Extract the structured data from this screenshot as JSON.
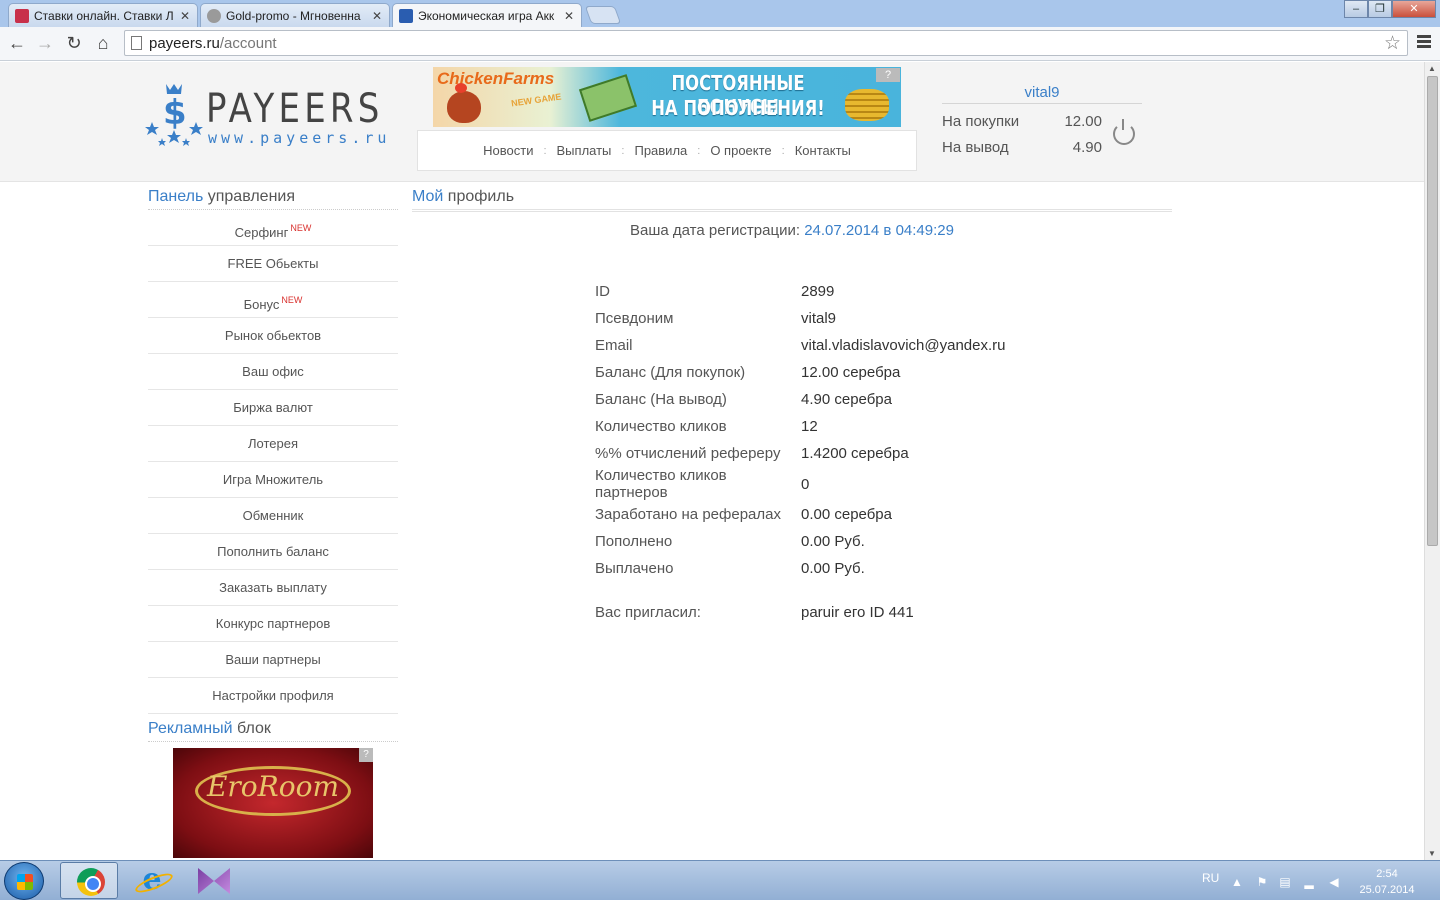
{
  "browser": {
    "tabs": [
      {
        "title": "Ставки онлайн. Ставки Л",
        "favicon_color": "#c8304a"
      },
      {
        "title": "Gold-promo - Мгновенна",
        "favicon_color": "#9a9a9a"
      },
      {
        "title": "Экономическая игра Акк",
        "favicon_color": "#2a5db0"
      }
    ],
    "url_host": "payeers.ru",
    "url_path": "/account"
  },
  "header": {
    "logo_brand": "PAYEERS",
    "logo_site": "www.payeers.ru",
    "banner": {
      "brand": "ChickenFarms",
      "badge": "NEW GAME",
      "line1": "ПОСТОЯННЫЕ БОНУСЫ",
      "line2": "НА ПОПОЛНЕНИЯ!",
      "help": "?"
    },
    "nav": [
      "Новости",
      "Выплаты",
      "Правила",
      "О проекте",
      "Контакты"
    ],
    "nav_separator": ":",
    "user": {
      "name": "vital9",
      "purchase_label": "На покупки",
      "purchase_value": "12.00",
      "withdraw_label": "На вывод",
      "withdraw_value": "4.90"
    }
  },
  "sidebar": {
    "title_hl": "Панель",
    "title_rest": "управления",
    "items": [
      {
        "label": "Серфинг",
        "badge": "NEW"
      },
      {
        "label": "FREE Обьекты",
        "badge": ""
      },
      {
        "label": "Бонус",
        "badge": "NEW"
      },
      {
        "label": "Рынок обьектов",
        "badge": ""
      },
      {
        "label": "Ваш офис",
        "badge": ""
      },
      {
        "label": "Биржа валют",
        "badge": ""
      },
      {
        "label": "Лотерея",
        "badge": ""
      },
      {
        "label": "Игра Множитель",
        "badge": ""
      },
      {
        "label": "Обменник",
        "badge": ""
      },
      {
        "label": "Пополнить баланс",
        "badge": ""
      },
      {
        "label": "Заказать выплату",
        "badge": ""
      },
      {
        "label": "Конкурс партнеров",
        "badge": ""
      },
      {
        "label": "Ваши партнеры",
        "badge": ""
      },
      {
        "label": "Настройки профиля",
        "badge": ""
      }
    ],
    "ad_title_hl": "Рекламный",
    "ad_title_rest": "блок",
    "ad_text": "EroRoom",
    "ad_help": "?"
  },
  "main": {
    "title_hl": "Мой",
    "title_rest": "профиль",
    "reg_label": "Ваша дата регистрации:",
    "reg_date": "24.07.2014 в 04:49:29",
    "profile": [
      {
        "k": "ID",
        "v": "2899"
      },
      {
        "k": "Псевдоним",
        "v": "vital9"
      },
      {
        "k": "Email",
        "v": "vital.vladislavovich@yandex.ru"
      },
      {
        "k": "Баланс (Для покупок)",
        "v": "12.00 серебра"
      },
      {
        "k": "Баланс (На вывод)",
        "v": "4.90 серебра"
      },
      {
        "k": "Количество кликов",
        "v": "12"
      },
      {
        "k": "%% отчислений рефереру",
        "v": "1.4200 серебра"
      },
      {
        "k": "Количество кликов партнеров",
        "v": "0"
      },
      {
        "k": "Заработано на рефералах",
        "v": "0.00 серебра"
      },
      {
        "k": "Пополнено",
        "v": "0.00 Руб."
      },
      {
        "k": "Выплачено",
        "v": "0.00 Руб."
      }
    ],
    "invited_label": "Вас пригласил:",
    "invited_value": "paruir его ID 441"
  },
  "taskbar": {
    "lang": "RU",
    "time": "2:54",
    "date": "25.07.2014"
  }
}
